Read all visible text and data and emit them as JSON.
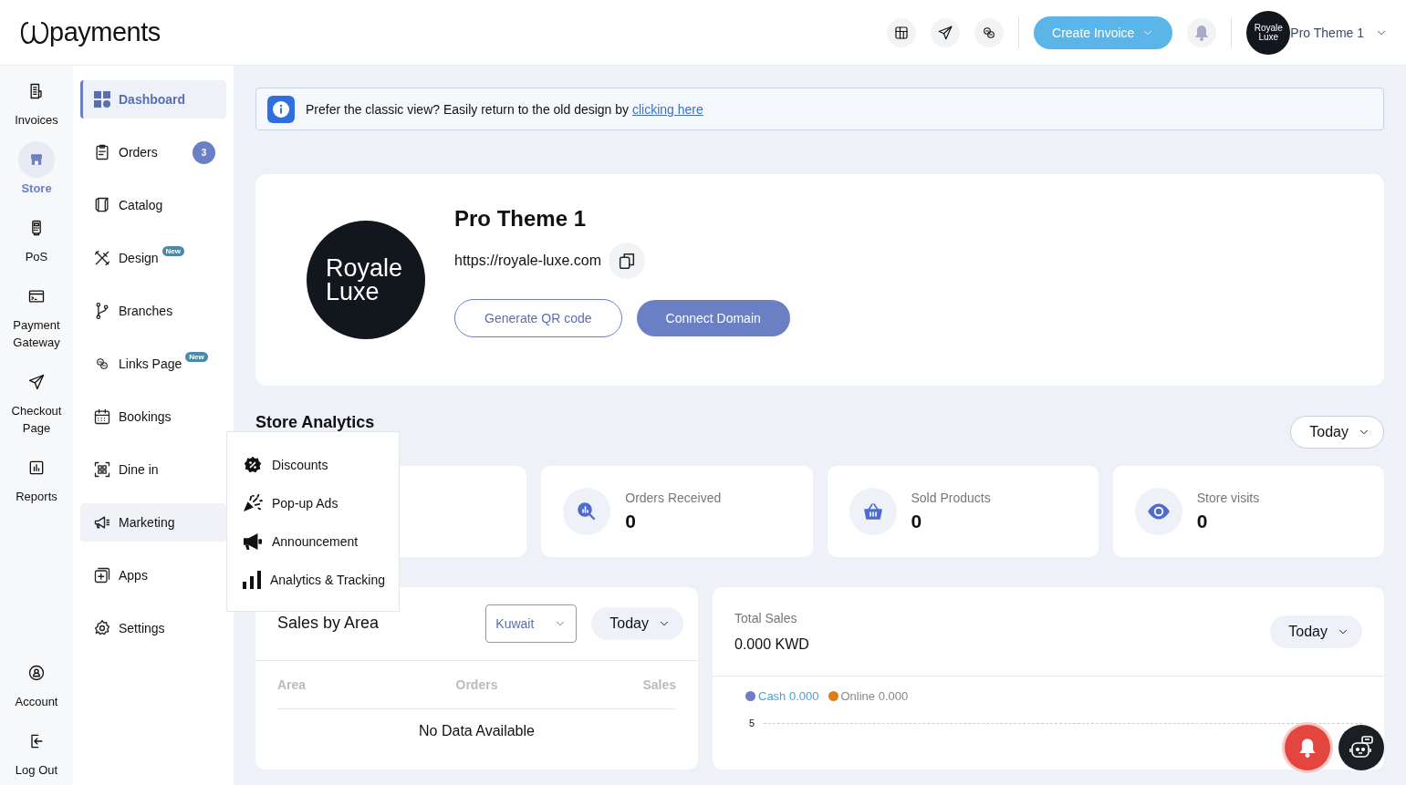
{
  "header": {
    "logo_text": "payments",
    "create_button": "Create Invoice",
    "profile": {
      "avatar_lines": [
        "Royale",
        "Luxe"
      ],
      "name": "Pro Theme 1"
    }
  },
  "rail": {
    "items": [
      {
        "kind": "invoices",
        "label": "Invoices",
        "selected": false
      },
      {
        "kind": "store",
        "label": "Store",
        "selected": true
      },
      {
        "kind": "pos",
        "label": "PoS",
        "selected": false
      },
      {
        "kind": "gateway",
        "label": "Payment Gateway",
        "selected": false
      },
      {
        "kind": "checkout",
        "label": "Checkout Page",
        "selected": false
      },
      {
        "kind": "reports",
        "label": "Reports",
        "selected": false
      }
    ],
    "bottom_items": [
      {
        "kind": "account",
        "label": "Account",
        "selected": false
      },
      {
        "kind": "logout",
        "label": "Log Out",
        "selected": false
      }
    ]
  },
  "sidebar": {
    "items": [
      {
        "kind": "dashboard",
        "label": "Dashboard",
        "selected": true,
        "expanded": false
      },
      {
        "kind": "orders",
        "label": "Orders",
        "badge": "3",
        "selected": false,
        "expanded": false
      },
      {
        "kind": "catalog",
        "label": "Catalog",
        "selected": false,
        "expanded": false
      },
      {
        "kind": "design",
        "label": "Design",
        "tag": "New",
        "selected": false,
        "expanded": false
      },
      {
        "kind": "branches",
        "label": "Branches",
        "selected": false,
        "expanded": false
      },
      {
        "kind": "links",
        "label": "Links Page",
        "tag": "New",
        "selected": false,
        "expanded": false
      },
      {
        "kind": "bookings",
        "label": "Bookings",
        "selected": false,
        "expanded": false
      },
      {
        "kind": "dinein",
        "label": "Dine in",
        "selected": false,
        "expanded": false
      },
      {
        "kind": "marketing",
        "label": "Marketing",
        "selected": false,
        "expanded": true,
        "submenu": [
          {
            "kind": "discounts",
            "label": "Discounts"
          },
          {
            "kind": "popup",
            "label": "Pop-up Ads"
          },
          {
            "kind": "announcement",
            "label": "Announcement"
          },
          {
            "kind": "analytics",
            "label": "Analytics & Tracking"
          }
        ]
      },
      {
        "kind": "apps",
        "label": "Apps",
        "selected": false,
        "expanded": false
      },
      {
        "kind": "settings",
        "label": "Settings",
        "selected": false,
        "expanded": false
      }
    ]
  },
  "notice": {
    "text": "Prefer the classic view? Easily return to the old design by",
    "link": "clicking here"
  },
  "store": {
    "logo_lines": [
      "Royale",
      "Luxe"
    ],
    "name": "Pro Theme 1",
    "url": "https://royale-luxe.com",
    "buttons": [
      {
        "kind": "outline",
        "label": "Generate QR code"
      },
      {
        "kind": "filled",
        "label": "Connect Domain"
      }
    ]
  },
  "analytics": {
    "title": "Store Analytics",
    "period": "Today",
    "cards": [
      {
        "kind": "blank"
      },
      {
        "kind": "orders",
        "label": "Orders Received",
        "value": "0"
      },
      {
        "kind": "products",
        "label": "Sold Products",
        "value": "0"
      },
      {
        "kind": "visits",
        "label": "Store visits",
        "value": "0"
      }
    ]
  },
  "sales_by_area": {
    "title": "Sales by Area",
    "region": "Kuwait",
    "period": "Today",
    "columns": [
      "Area",
      "Orders",
      "Sales"
    ],
    "empty_text": "No Data Available"
  },
  "total_sales": {
    "title": "Total Sales",
    "amount": "0.000 KWD",
    "period": "Today",
    "legend": [
      {
        "label": "Cash 0.000",
        "color": "#6b7fc4",
        "active": true
      },
      {
        "label": "Online 0.000",
        "color": "#e07b1a",
        "active": false
      }
    ],
    "axis_label": "5"
  }
}
